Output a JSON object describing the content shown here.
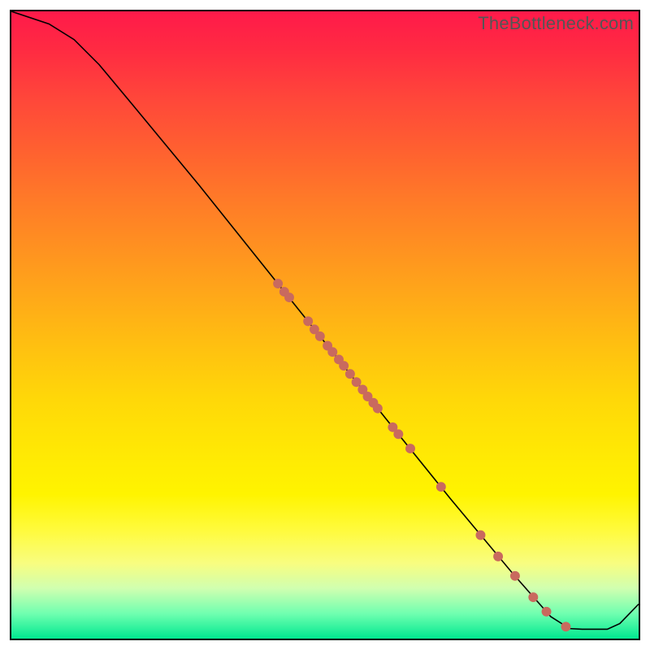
{
  "watermark": "TheBottleneck.com",
  "colors": {
    "dot": "#c96a5e",
    "line": "#000000",
    "border": "#000000"
  },
  "chart_data": {
    "type": "line",
    "title": "",
    "xlabel": "",
    "ylabel": "",
    "xlim": [
      0,
      100
    ],
    "ylim": [
      0,
      100
    ],
    "grid": false,
    "legend": false,
    "curve": [
      {
        "x": 0,
        "y": 100
      },
      {
        "x": 6,
        "y": 98
      },
      {
        "x": 10,
        "y": 95.5
      },
      {
        "x": 14,
        "y": 91.5
      },
      {
        "x": 20,
        "y": 84.3
      },
      {
        "x": 30,
        "y": 72.2
      },
      {
        "x": 40,
        "y": 59.7
      },
      {
        "x": 50,
        "y": 47.2
      },
      {
        "x": 60,
        "y": 34.7
      },
      {
        "x": 70,
        "y": 22.3
      },
      {
        "x": 80,
        "y": 10.3
      },
      {
        "x": 86,
        "y": 3.5
      },
      {
        "x": 89,
        "y": 1.6
      },
      {
        "x": 91,
        "y": 1.5
      },
      {
        "x": 95,
        "y": 1.5
      },
      {
        "x": 97,
        "y": 2.4
      },
      {
        "x": 100,
        "y": 5.5
      }
    ],
    "points": [
      {
        "x": 42.5,
        "y": 56.6
      },
      {
        "x": 43.5,
        "y": 55.3
      },
      {
        "x": 44.3,
        "y": 54.4
      },
      {
        "x": 47.3,
        "y": 50.6
      },
      {
        "x": 48.3,
        "y": 49.3
      },
      {
        "x": 49.2,
        "y": 48.2
      },
      {
        "x": 50.4,
        "y": 46.7
      },
      {
        "x": 51.2,
        "y": 45.7
      },
      {
        "x": 52.2,
        "y": 44.5
      },
      {
        "x": 53.0,
        "y": 43.5
      },
      {
        "x": 54.0,
        "y": 42.2
      },
      {
        "x": 55.0,
        "y": 40.9
      },
      {
        "x": 56.0,
        "y": 39.7
      },
      {
        "x": 56.8,
        "y": 38.6
      },
      {
        "x": 57.7,
        "y": 37.6
      },
      {
        "x": 58.4,
        "y": 36.7
      },
      {
        "x": 60.8,
        "y": 33.7
      },
      {
        "x": 61.7,
        "y": 32.6
      },
      {
        "x": 63.6,
        "y": 30.3
      },
      {
        "x": 68.5,
        "y": 24.2
      },
      {
        "x": 74.8,
        "y": 16.5
      },
      {
        "x": 77.6,
        "y": 13.1
      },
      {
        "x": 80.3,
        "y": 10.0
      },
      {
        "x": 83.2,
        "y": 6.6
      },
      {
        "x": 85.3,
        "y": 4.3
      },
      {
        "x": 88.4,
        "y": 1.9
      }
    ],
    "dot_radius": 6
  }
}
